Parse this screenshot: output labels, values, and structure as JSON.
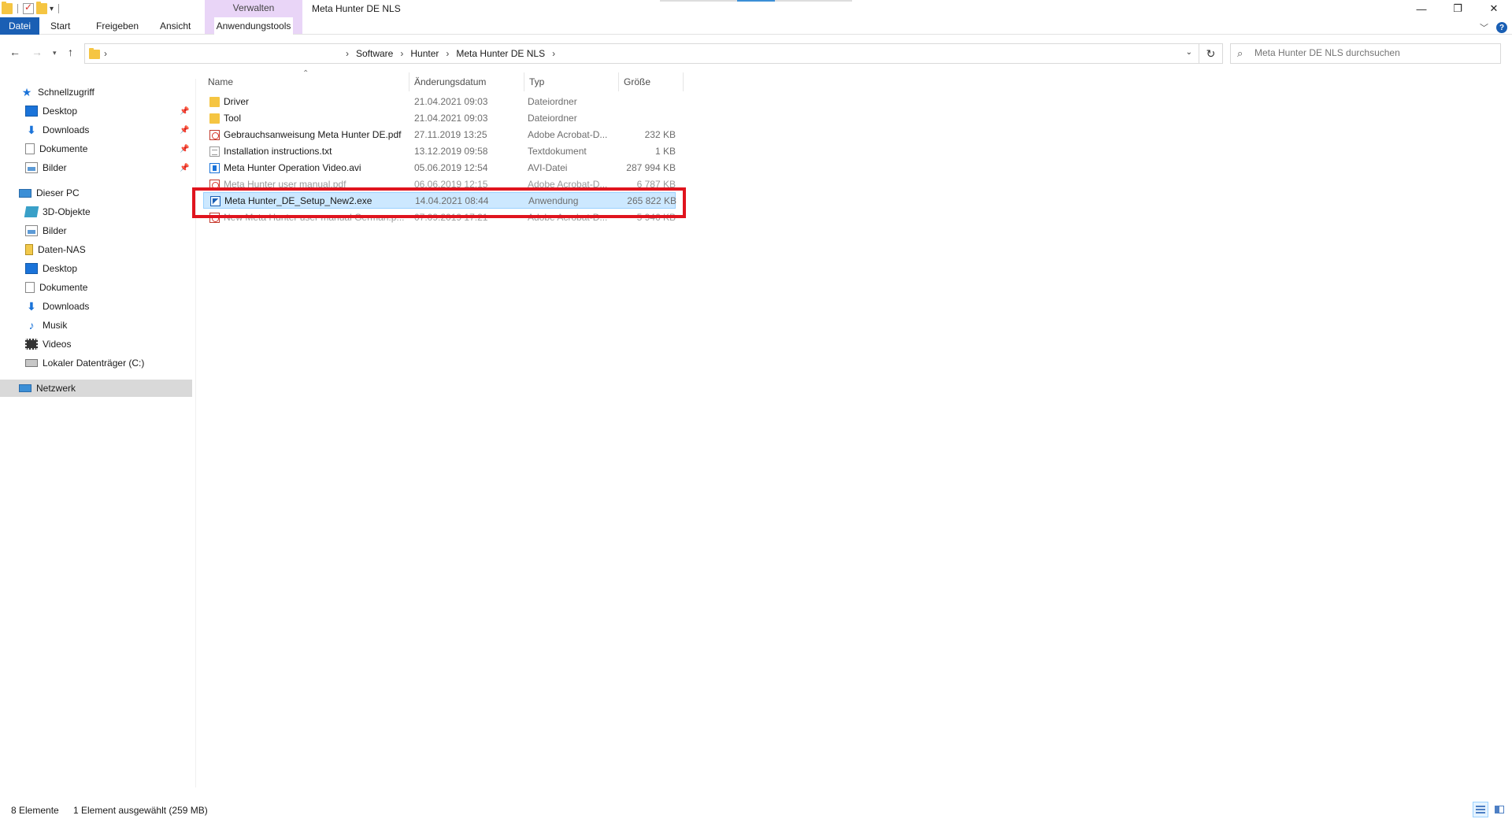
{
  "window": {
    "title": "Meta Hunter DE NLS",
    "context_group": "Verwalten",
    "controls": {
      "minimize": "—",
      "restore": "❐",
      "close": "✕"
    }
  },
  "ribbon": {
    "tabs": [
      {
        "label": "Datei"
      },
      {
        "label": "Start"
      },
      {
        "label": "Freigeben"
      },
      {
        "label": "Ansicht"
      },
      {
        "label": "Anwendungstools"
      }
    ],
    "help_label": "?"
  },
  "address": {
    "crumbs": [
      "Software",
      "Hunter",
      "Meta Hunter DE NLS"
    ],
    "separator": "›"
  },
  "search": {
    "placeholder": "Meta Hunter DE NLS durchsuchen"
  },
  "sidebar": {
    "quick_access": {
      "label": "Schnellzugriff",
      "items": [
        {
          "label": "Desktop",
          "icon": "desktop-icon",
          "pinned": true
        },
        {
          "label": "Downloads",
          "icon": "download-icon",
          "pinned": true
        },
        {
          "label": "Dokumente",
          "icon": "document-icon",
          "pinned": true
        },
        {
          "label": "Bilder",
          "icon": "pictures-icon",
          "pinned": true
        }
      ]
    },
    "this_pc": {
      "label": "Dieser PC",
      "items": [
        {
          "label": "3D-Objekte",
          "icon": "3d-objects-icon"
        },
        {
          "label": "Bilder",
          "icon": "pictures-icon"
        },
        {
          "label": "Daten-NAS",
          "icon": "nas-drive-icon"
        },
        {
          "label": "Desktop",
          "icon": "desktop-icon"
        },
        {
          "label": "Dokumente",
          "icon": "document-icon"
        },
        {
          "label": "Downloads",
          "icon": "download-icon"
        },
        {
          "label": "Musik",
          "icon": "music-icon"
        },
        {
          "label": "Videos",
          "icon": "videos-icon"
        },
        {
          "label": "Lokaler Datenträger (C:)",
          "icon": "local-drive-icon"
        }
      ]
    },
    "network": {
      "label": "Netzwerk"
    }
  },
  "columns": {
    "name": "Name",
    "date": "Änderungsdatum",
    "type": "Typ",
    "size": "Größe"
  },
  "files": [
    {
      "name": "Driver",
      "date": "21.04.2021 09:03",
      "type": "Dateiordner",
      "size": "",
      "icon": "folder-icon"
    },
    {
      "name": "Tool",
      "date": "21.04.2021 09:03",
      "type": "Dateiordner",
      "size": "",
      "icon": "folder-icon"
    },
    {
      "name": "Gebrauchsanweisung Meta Hunter DE.pdf",
      "date": "27.11.2019 13:25",
      "type": "Adobe Acrobat-D...",
      "size": "232 KB",
      "icon": "pdf-icon"
    },
    {
      "name": "Installation instructions.txt",
      "date": "13.12.2019 09:58",
      "type": "Textdokument",
      "size": "1 KB",
      "icon": "text-file-icon"
    },
    {
      "name": "Meta Hunter Operation Video.avi",
      "date": "05.06.2019 12:54",
      "type": "AVI-Datei",
      "size": "287 994 KB",
      "icon": "video-file-icon"
    },
    {
      "name": "Meta Hunter user manual.pdf",
      "date": "06.06.2019 12:15",
      "type": "Adobe Acrobat-D...",
      "size": "6 787 KB",
      "icon": "pdf-icon"
    },
    {
      "name": "Meta Hunter_DE_Setup_New2.exe",
      "date": "14.04.2021 08:44",
      "type": "Anwendung",
      "size": "265 822 KB",
      "icon": "application-icon",
      "selected": true
    },
    {
      "name": "New Meta Hunter user manual German.p...",
      "date": "07.09.2019 17:21",
      "type": "Adobe Acrobat-D...",
      "size": "5 946 KB",
      "icon": "pdf-icon"
    }
  ],
  "status": {
    "count": "8 Elemente",
    "selection": "1 Element ausgewählt (259 MB)"
  },
  "colors": {
    "accent": "#1a5fb4",
    "selection": "#cce8ff",
    "highlight_frame": "#e0141e",
    "context_tab": "#e9d5f7"
  }
}
